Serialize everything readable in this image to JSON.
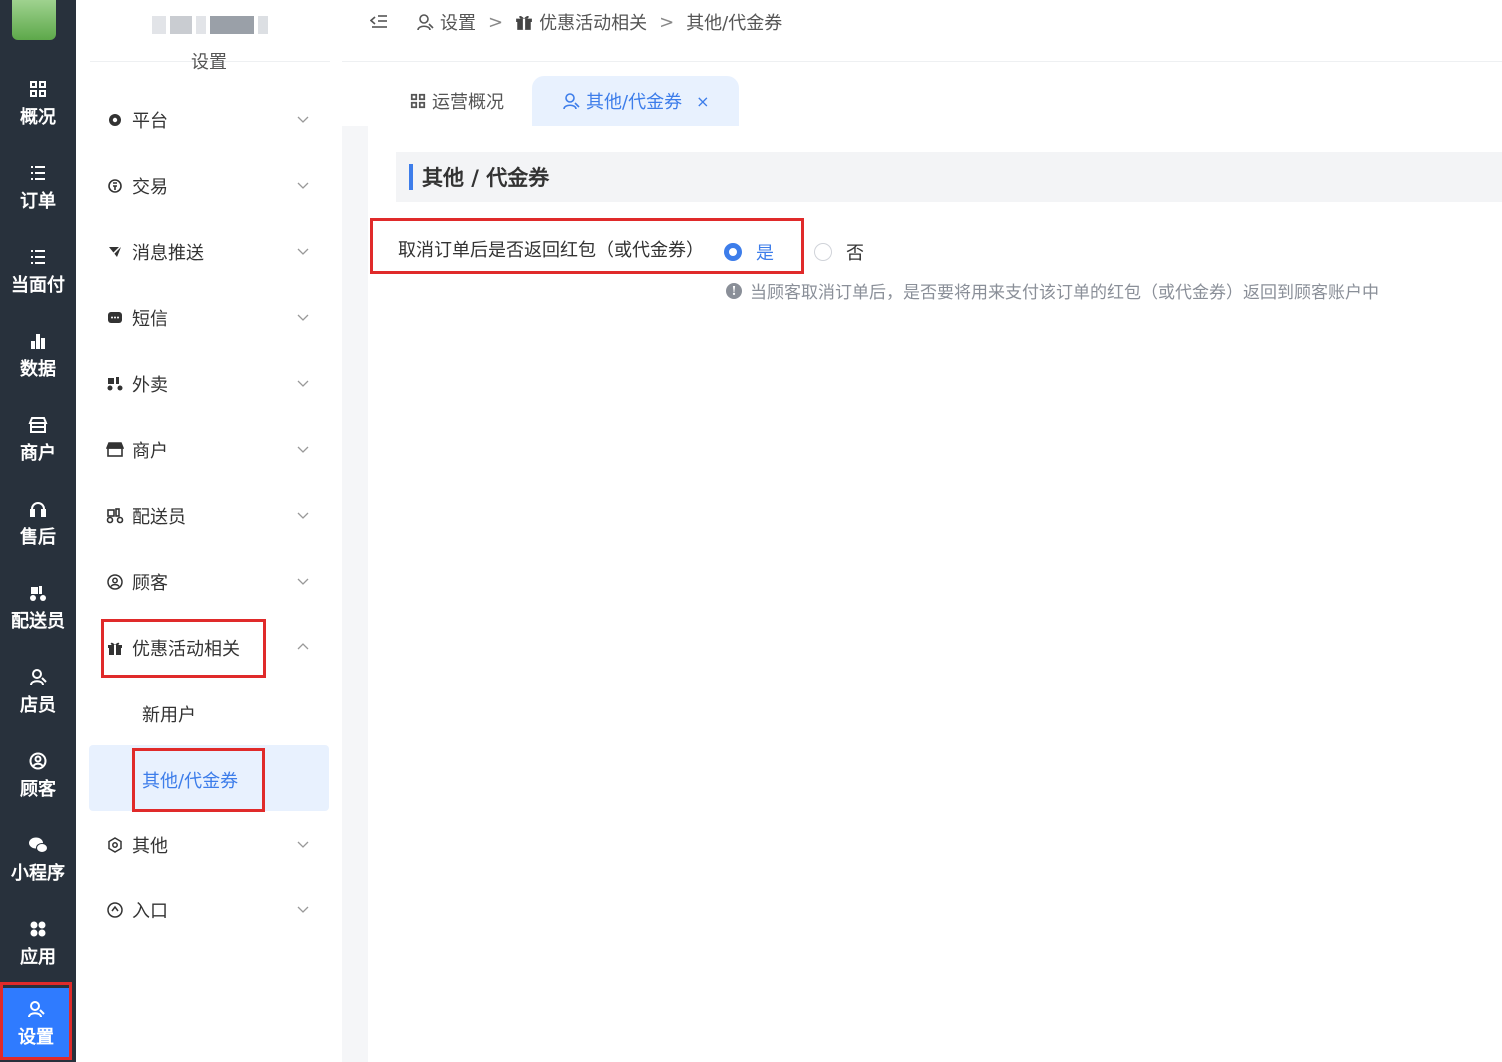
{
  "left_nav": {
    "items": [
      {
        "label": "概况",
        "icon": "dashboard-grid-icon"
      },
      {
        "label": "订单",
        "icon": "list-icon"
      },
      {
        "label": "当面付",
        "icon": "list-icon"
      },
      {
        "label": "数据",
        "icon": "bar-chart-icon"
      },
      {
        "label": "商户",
        "icon": "store-icon"
      },
      {
        "label": "售后",
        "icon": "headset-icon"
      },
      {
        "label": "配送员",
        "icon": "delivery-scooter-icon"
      },
      {
        "label": "店员",
        "icon": "staff-user-icon"
      },
      {
        "label": "顾客",
        "icon": "customer-circle-icon"
      },
      {
        "label": "小程序",
        "icon": "wechat-icon"
      },
      {
        "label": "应用",
        "icon": "apps-icon"
      },
      {
        "label": "设置",
        "icon": "settings-user-icon"
      }
    ],
    "active_index": 11
  },
  "sidebar": {
    "title": "设置",
    "items": [
      {
        "label": "平台",
        "icon": "gear-icon"
      },
      {
        "label": "交易",
        "icon": "trade-icon"
      },
      {
        "label": "消息推送",
        "icon": "push-icon"
      },
      {
        "label": "短信",
        "icon": "sms-icon"
      },
      {
        "label": "外卖",
        "icon": "delivery-icon"
      },
      {
        "label": "商户",
        "icon": "store-icon"
      },
      {
        "label": "配送员",
        "icon": "rider-icon"
      },
      {
        "label": "顾客",
        "icon": "customer-icon"
      },
      {
        "label": "优惠活动相关",
        "icon": "gift-icon"
      },
      {
        "label": "其他",
        "icon": "other-hex-icon"
      },
      {
        "label": "入口",
        "icon": "entry-icon"
      }
    ],
    "sub_items": [
      {
        "label": "新用户"
      },
      {
        "label": "其他/代金券"
      }
    ]
  },
  "breadcrumb": {
    "items": [
      "设置",
      "优惠活动相关",
      "其他/代金券"
    ],
    "separator": ">"
  },
  "tabs": [
    {
      "label": "运营概况"
    },
    {
      "label": "其他/代金券",
      "close": "×"
    }
  ],
  "main": {
    "section_title": "其他 / 代金券",
    "field_label": "取消订单后是否返回红包（或代金券）",
    "options": [
      "是",
      "否"
    ],
    "selected": "是",
    "hint": "当顾客取消订单后，是否要将用来支付该订单的红包（或代金券）返回到顾客账户中",
    "hint_icon": "!"
  },
  "colors": {
    "accent": "#3d7dea",
    "nav_bg": "#28313c",
    "nav_active": "#2f7bff",
    "highlight_box": "#e02a2a"
  }
}
